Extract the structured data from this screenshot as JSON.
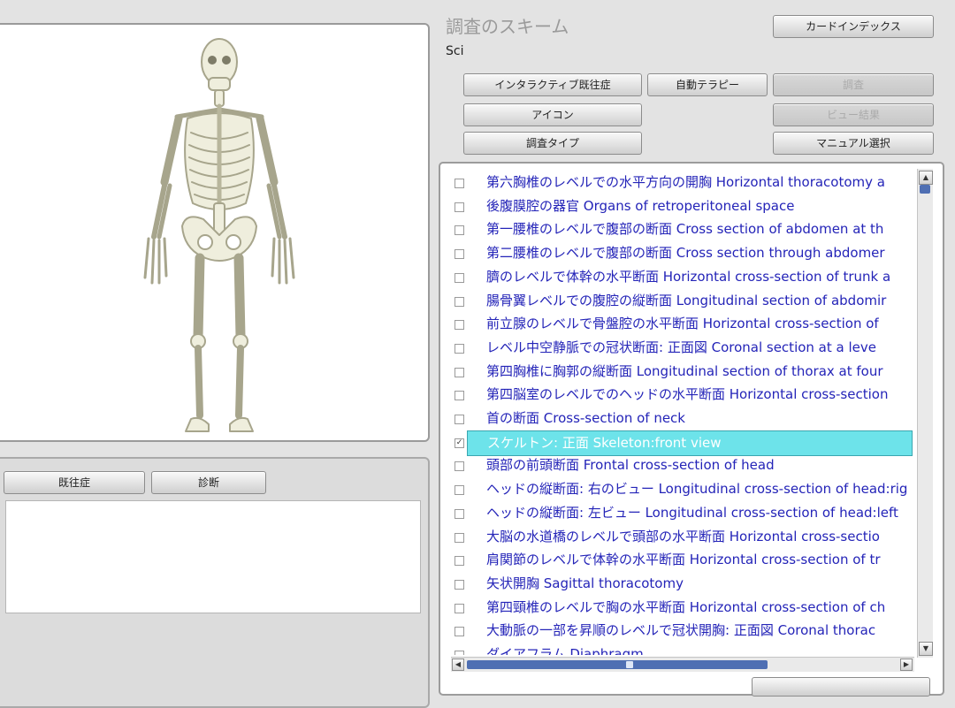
{
  "scheme": {
    "title": "調査のスキーム",
    "value": "Sci"
  },
  "buttons": {
    "card_index": "カードインデックス",
    "interactive_history": "インタラクティブ既往症",
    "auto_therapy": "自動テラピー",
    "survey": "調査",
    "icon": "アイコン",
    "view_result": "ビュー結果",
    "survey_type": "調査タイプ",
    "manual_select": "マニュアル選択",
    "history": "既往症",
    "diagnosis": "診断"
  },
  "list": {
    "items": [
      {
        "label": "第六胸椎のレベルでの水平方向の開胸 Horizontal thoracotomy a",
        "checked": false
      },
      {
        "label": "後腹膜腔の器官 Organs of retroperitoneal space",
        "checked": false
      },
      {
        "label": "第一腰椎のレベルで腹部の断面 Cross section of abdomen at th",
        "checked": false
      },
      {
        "label": "第二腰椎のレベルで腹部の断面 Cross section through abdomer",
        "checked": false
      },
      {
        "label": "臍のレベルで体幹の水平断面 Horizontal cross-section of trunk a",
        "checked": false
      },
      {
        "label": "腸骨翼レベルでの腹腔の縦断面 Longitudinal section of abdomir",
        "checked": false
      },
      {
        "label": "前立腺のレベルで骨盤腔の水平断面 Horizontal cross-section of",
        "checked": false
      },
      {
        "label": "レベル中空静脈での冠状断面: 正面図 Coronal section at a leve",
        "checked": false
      },
      {
        "label": "第四胸椎に胸郭の縦断面 Longitudinal section of thorax at four",
        "checked": false
      },
      {
        "label": "第四脳室のレベルでのヘッドの水平断面 Horizontal cross-section",
        "checked": false
      },
      {
        "label": "首の断面 Cross-section of neck",
        "checked": false
      },
      {
        "label": "スケルトン: 正面 Skeleton:front view",
        "checked": true,
        "selected": true
      },
      {
        "label": "頭部の前頭断面 Frontal cross-section of head",
        "checked": false
      },
      {
        "label": "ヘッドの縦断面: 右のビュー Longitudinal cross-section of head:rig",
        "checked": false
      },
      {
        "label": "ヘッドの縦断面: 左ビュー Longitudinal cross-section of head:left",
        "checked": false
      },
      {
        "label": "大脳の水道橋のレベルで頭部の水平断面 Horizontal cross-sectio",
        "checked": false
      },
      {
        "label": "肩関節のレベルで体幹の水平断面 Horizontal cross-section of tr",
        "checked": false
      },
      {
        "label": "矢状開胸 Sagittal thoracotomy",
        "checked": false
      },
      {
        "label": "第四頸椎のレベルで胸の水平断面 Horizontal cross-section of ch",
        "checked": false
      },
      {
        "label": "大動脈の一部を昇順のレベルで冠状開胸: 正面図 Coronal thorac",
        "checked": false
      },
      {
        "label": "ダイアフラム Diaphragm",
        "checked": false
      }
    ]
  },
  "viewer": {
    "model": "skeleton-front-view"
  },
  "colors": {
    "link": "#2424b8",
    "selection": "#6de3ea",
    "scroll_thumb": "#4f6fb3"
  }
}
